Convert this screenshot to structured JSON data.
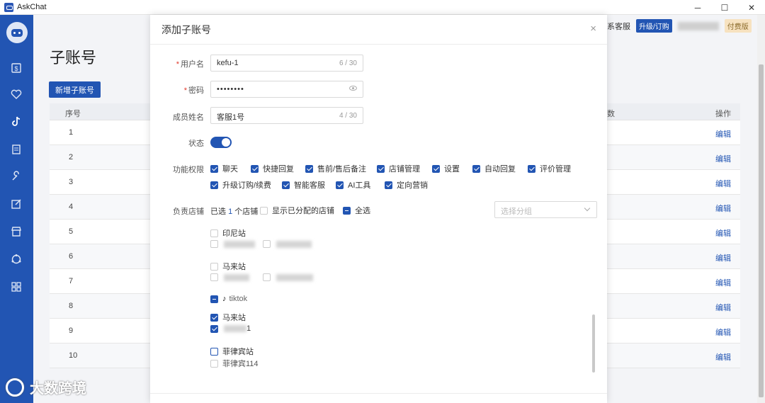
{
  "window": {
    "title": "AskChat",
    "controls": {
      "minimize": "─",
      "maximize": "☐",
      "close": "✕"
    }
  },
  "sidebar": {
    "icons": [
      "logo-icon",
      "wallet-icon",
      "heart-icon",
      "tiktok-icon",
      "document-icon",
      "wrench-icon",
      "edit-icon",
      "store-icon",
      "cycle-icon",
      "grid-icon"
    ]
  },
  "watermark": {
    "text": "大数跨境"
  },
  "topbar": {
    "service_label": "系客服",
    "upgrade_label": "升级/订购",
    "plan_badge": "付费版"
  },
  "page": {
    "title": "子账号",
    "new_button": "新增子账号",
    "table": {
      "headers": [
        "序号",
        "数",
        "操作"
      ],
      "rows": [
        "1",
        "2",
        "3",
        "4",
        "5",
        "6",
        "7",
        "8",
        "9",
        "10"
      ],
      "edit_label": "编辑"
    }
  },
  "modal": {
    "title": "添加子账号",
    "close": "×",
    "username": {
      "label": "用户名",
      "value": "kefu-1",
      "count": "6 / 30"
    },
    "password": {
      "label": "密码",
      "value": "••••••••"
    },
    "member_name": {
      "label": "成员姓名",
      "value": "客服1号",
      "count": "4 / 30"
    },
    "status": {
      "label": "状态",
      "enabled": true
    },
    "permissions": {
      "label": "功能权限",
      "items": [
        "聊天",
        "快捷回复",
        "售前/售后备注",
        "店铺管理",
        "设置",
        "自动回复",
        "评价管理",
        "升级订购/续费",
        "智能客服",
        "AI工具",
        "定向营销"
      ]
    },
    "stores": {
      "label": "负责店铺",
      "selected_prefix": "已选",
      "selected_count": "1",
      "selected_suffix": "个店铺",
      "show_assigned": "显示已分配的店铺",
      "select_all": "全选",
      "group_placeholder": "选择分组",
      "groups": {
        "indonesia": "印尼站",
        "malaysia1": "马来站",
        "tiktok": "tiktok",
        "malaysia2": "马来站",
        "malaysia2_store_suffix": "1",
        "philippines": "菲律宾站",
        "philippines_store": "菲律宾114"
      }
    }
  }
}
